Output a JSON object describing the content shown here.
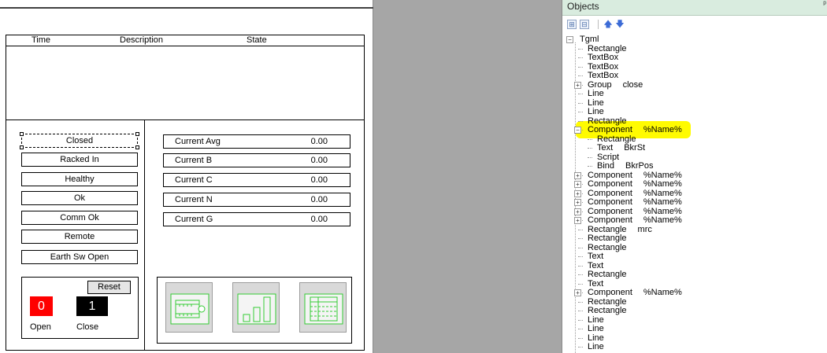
{
  "alarm_table": {
    "columns": [
      "Time",
      "Description",
      "State"
    ]
  },
  "status_labels": [
    "Closed",
    "Racked In",
    "Healthy",
    "Ok",
    "Comm Ok",
    "Remote",
    "Earth Sw Open"
  ],
  "meters": [
    {
      "name": "Current Avg",
      "value": "0.00"
    },
    {
      "name": "Current B",
      "value": "0.00"
    },
    {
      "name": "Current C",
      "value": "0.00"
    },
    {
      "name": "Current N",
      "value": "0.00"
    },
    {
      "name": "Current G",
      "value": "0.00"
    }
  ],
  "breaker": {
    "reset_label": "Reset",
    "open_value": "0",
    "close_value": "1",
    "open_label": "Open",
    "close_label": "Close",
    "open_color": "#ff0000",
    "close_color": "#000000"
  },
  "nav_buttons": [
    {
      "icon": "breaker-diagram-icon"
    },
    {
      "icon": "bar-chart-icon"
    },
    {
      "icon": "list-icon"
    }
  ],
  "objects_pane": {
    "title": "Objects",
    "toolbar": {
      "expand_icon": "expand-all-icon",
      "collapse_icon": "collapse-all-icon",
      "up_icon": "move-up-icon",
      "down_icon": "move-down-icon"
    },
    "highlight_color": "#fffb00",
    "tree": [
      {
        "type": "Tgml",
        "value": "",
        "level": 0,
        "expander": "minus"
      },
      {
        "type": "Rectangle",
        "value": "",
        "level": 1
      },
      {
        "type": "TextBox",
        "value": "",
        "level": 1
      },
      {
        "type": "TextBox",
        "value": "",
        "level": 1
      },
      {
        "type": "TextBox",
        "value": "",
        "level": 1
      },
      {
        "type": "Group",
        "value": "close",
        "level": 1,
        "expander": "plus"
      },
      {
        "type": "Line",
        "value": "",
        "level": 1
      },
      {
        "type": "Line",
        "value": "",
        "level": 1
      },
      {
        "type": "Line",
        "value": "",
        "level": 1
      },
      {
        "type": "Rectangle",
        "value": "",
        "level": 1
      },
      {
        "type": "Component",
        "value": "%Name%",
        "level": 1,
        "expander": "minus",
        "highlighted": true
      },
      {
        "type": "Rectangle",
        "value": "",
        "level": 2
      },
      {
        "type": "Text",
        "value": "BkrSt",
        "level": 2
      },
      {
        "type": "Script",
        "value": "",
        "level": 2
      },
      {
        "type": "Bind",
        "value": "BkrPos",
        "level": 2
      },
      {
        "type": "Component",
        "value": "%Name%",
        "level": 1,
        "expander": "plus"
      },
      {
        "type": "Component",
        "value": "%Name%",
        "level": 1,
        "expander": "plus"
      },
      {
        "type": "Component",
        "value": "%Name%",
        "level": 1,
        "expander": "plus"
      },
      {
        "type": "Component",
        "value": "%Name%",
        "level": 1,
        "expander": "plus"
      },
      {
        "type": "Component",
        "value": "%Name%",
        "level": 1,
        "expander": "plus"
      },
      {
        "type": "Component",
        "value": "%Name%",
        "level": 1,
        "expander": "plus"
      },
      {
        "type": "Rectangle",
        "value": "mrc",
        "level": 1
      },
      {
        "type": "Rectangle",
        "value": "",
        "level": 1
      },
      {
        "type": "Rectangle",
        "value": "",
        "level": 1
      },
      {
        "type": "Text",
        "value": "",
        "level": 1
      },
      {
        "type": "Text",
        "value": "",
        "level": 1
      },
      {
        "type": "Rectangle",
        "value": "",
        "level": 1
      },
      {
        "type": "Text",
        "value": "",
        "level": 1
      },
      {
        "type": "Component",
        "value": "%Name%",
        "level": 1,
        "expander": "plus"
      },
      {
        "type": "Rectangle",
        "value": "",
        "level": 1
      },
      {
        "type": "Rectangle",
        "value": "",
        "level": 1
      },
      {
        "type": "Line",
        "value": "",
        "level": 1
      },
      {
        "type": "Line",
        "value": "",
        "level": 1
      },
      {
        "type": "Line",
        "value": "",
        "level": 1
      },
      {
        "type": "Line",
        "value": "",
        "level": 1
      }
    ]
  }
}
